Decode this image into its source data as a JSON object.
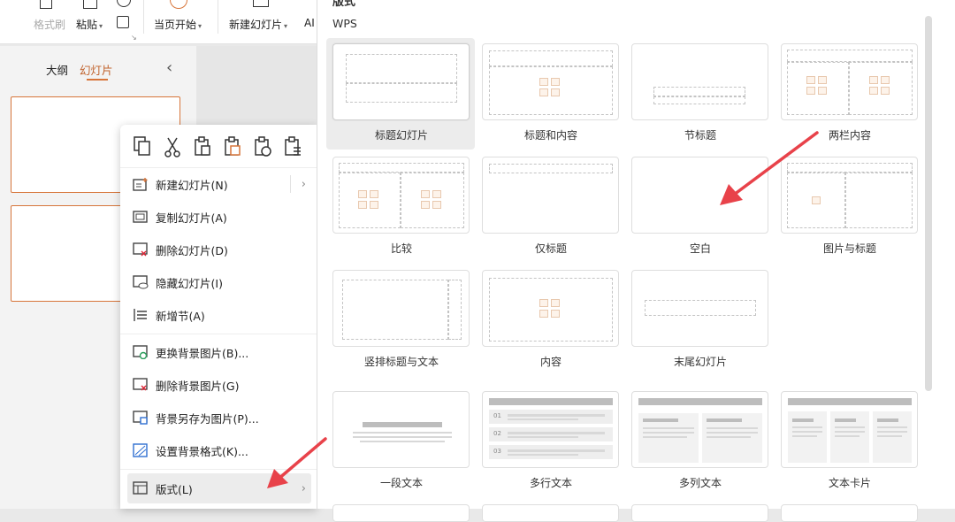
{
  "toolbar": {
    "format_painter": "格式刷",
    "paste": "粘贴",
    "from_current": "当页开始",
    "new_slide": "新建幻灯片",
    "ai_cut": "AI"
  },
  "outline_tabs": {
    "outline": "大纲",
    "slides": "幻灯片",
    "collapse": "‹"
  },
  "context_menu": {
    "items": [
      {
        "label": "新建幻灯片(N)",
        "submenu": true
      },
      {
        "label": "复制幻灯片(A)"
      },
      {
        "label": "删除幻灯片(D)"
      },
      {
        "label": "隐藏幻灯片(I)"
      },
      {
        "label": "新增节(A)"
      },
      {
        "label": "更换背景图片(B)..."
      },
      {
        "label": "删除背景图片(G)"
      },
      {
        "label": "背景另存为图片(P)..."
      },
      {
        "label": "设置背景格式(K)..."
      },
      {
        "label": "版式(L)",
        "submenu": true
      }
    ],
    "submenu_arrow": "›"
  },
  "layout_panel": {
    "header_cut": "版式",
    "section": "WPS",
    "layouts": [
      {
        "label": "标题幻灯片",
        "selected": true
      },
      {
        "label": "标题和内容"
      },
      {
        "label": "节标题"
      },
      {
        "label": "两栏内容"
      },
      {
        "label": "比较"
      },
      {
        "label": "仅标题"
      },
      {
        "label": "空白"
      },
      {
        "label": "图片与标题"
      },
      {
        "label": "竖排标题与文本"
      },
      {
        "label": "内容"
      },
      {
        "label": "末尾幻灯片"
      }
    ],
    "templates": [
      {
        "label": "一段文本"
      },
      {
        "label": "多行文本",
        "rows": [
          "01",
          "02",
          "03"
        ]
      },
      {
        "label": "多列文本"
      },
      {
        "label": "文本卡片"
      }
    ]
  },
  "colors": {
    "accent": "#d7753a",
    "arrow": "#e8424a"
  }
}
